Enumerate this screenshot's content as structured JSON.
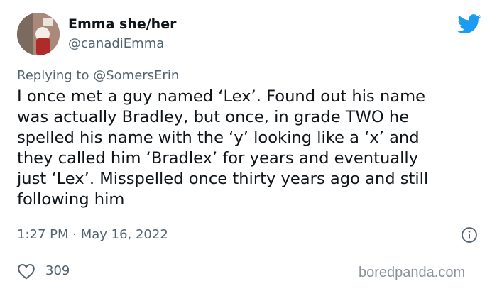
{
  "author": {
    "display_name": "Emma she/her",
    "handle": "@canadiEmma"
  },
  "reply": {
    "prefix": "Replying to",
    "target": "@SomersErin"
  },
  "tweet": {
    "text": "I once met a guy named ‘Lex’. Found out his name\nwas actually Bradley, but once, in grade TWO he\nspelled his name with the ‘y’ looking like a ‘x’ and\nthey called him ‘Bradlex’ for years and eventually\njust ‘Lex’. Misspelled once thirty years ago and still\nfollowing him",
    "timestamp": "1:27 PM · May 16, 2022",
    "likes": "309"
  },
  "watermark": "boredpanda.com",
  "icons": {
    "brand": "twitter-bird-icon",
    "info": "info-icon",
    "like": "heart-icon"
  },
  "colors": {
    "twitter_blue": "#1d9bf0",
    "secondary_text": "#536471",
    "divider": "#cfd9de"
  }
}
